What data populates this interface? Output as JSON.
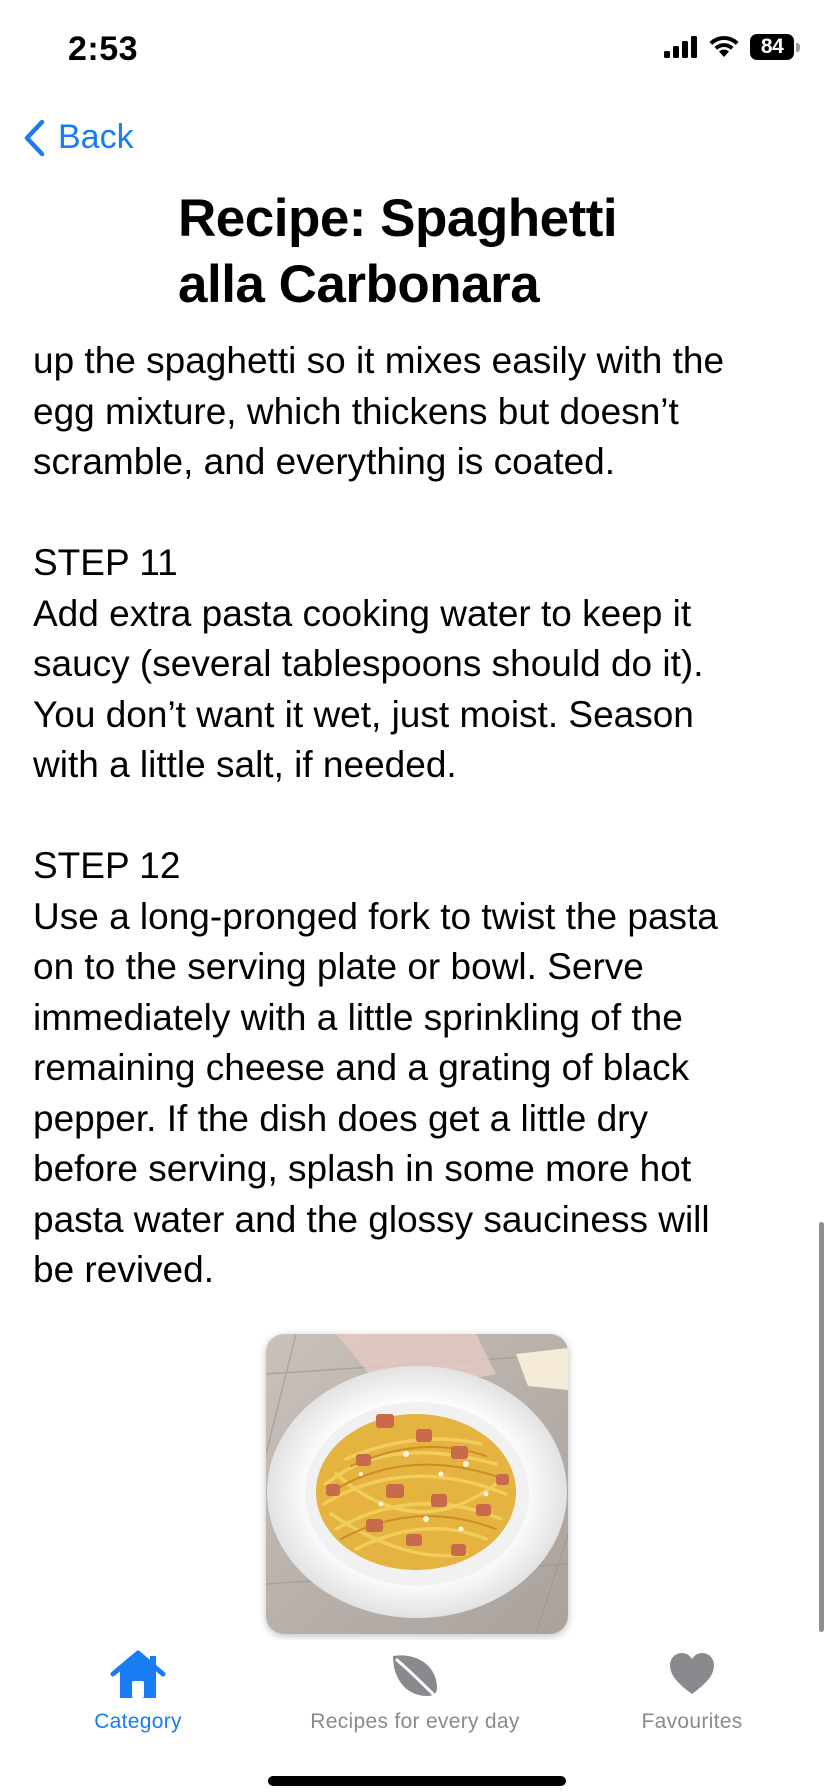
{
  "status_bar": {
    "time": "2:53",
    "battery": "84",
    "icons": [
      "signal-icon",
      "wifi-icon",
      "battery-icon"
    ]
  },
  "navigation": {
    "back_label": "Back",
    "title_line1": "Recipe: Spaghetti",
    "title_line2": "alla Carbonara",
    "accent_color": "#1a7cf5"
  },
  "content": {
    "step10_tail": {
      "line1": "up the spaghetti so it mixes easily with the",
      "line2": "egg mixture, which thickens but doesn’t",
      "line3": "scramble, and everything is coated."
    },
    "step11": {
      "heading": "STEP 11",
      "line1": "Add extra pasta cooking water to keep it",
      "line2": "saucy (several tablespoons should do it).",
      "line3": "You don’t want it wet, just moist. Season",
      "line4": "with a little salt, if needed."
    },
    "step12": {
      "heading": "STEP 12",
      "line1": "Use a long-pronged fork to twist the pasta",
      "line2": "on to the serving plate or bowl. Serve",
      "line3": "immediately with a little sprinkling of the",
      "line4": "remaining cheese and a grating of black",
      "line5": "pepper. If the dish does get a little dry",
      "line6": "before serving, splash in some more hot",
      "line7": "pasta water and the glossy sauciness will",
      "line8": "be revived."
    },
    "image_subject": "spaghetti-carbonara-plate"
  },
  "tab_bar": {
    "tabs": [
      {
        "label": "Category",
        "icon": "house-icon",
        "active": true
      },
      {
        "label": "Recipes for every day",
        "icon": "leaf-icon",
        "active": false
      },
      {
        "label": "Favourites",
        "icon": "heart-icon",
        "active": false
      }
    ],
    "active_color": "#1a7cf5",
    "inactive_color": "#8a8a8e"
  }
}
